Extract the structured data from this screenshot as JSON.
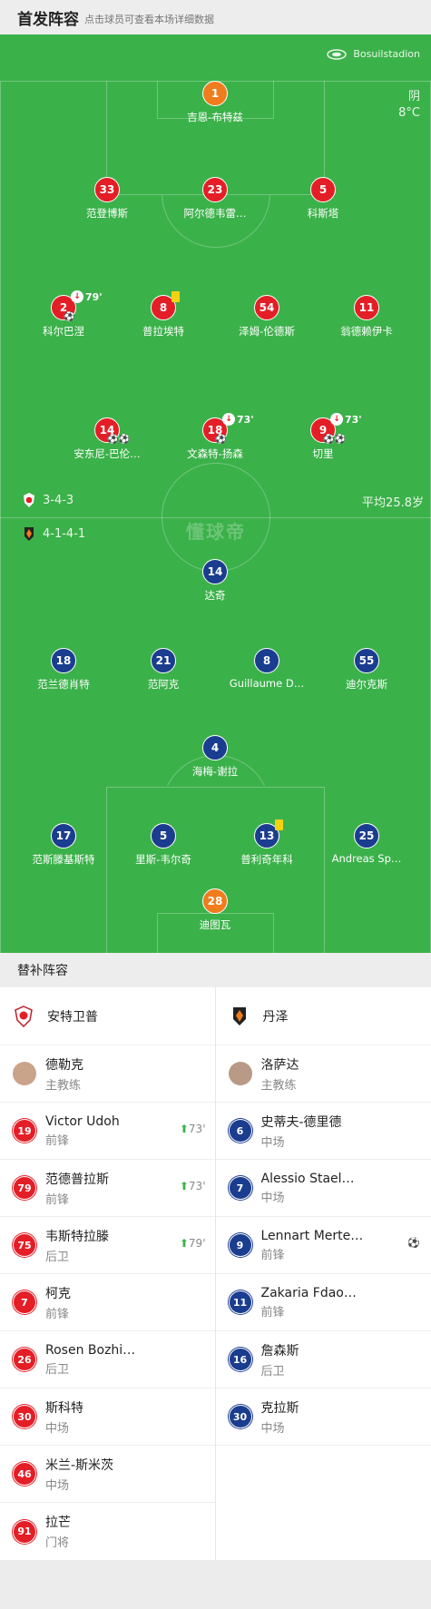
{
  "header": {
    "title": "首发阵容",
    "subtitle": "点击球员可查看本场详细数据"
  },
  "venue": "Bosuilstadion",
  "weather": {
    "cond": "阴",
    "temp": "8°C"
  },
  "watermark": "懂球帝",
  "home_formation": "3-4-3",
  "away_formation": "4-1-4-1",
  "avg_age": "平均25.8岁",
  "home_players": [
    {
      "num": "1",
      "name": "吉恩-布特兹"
    },
    {
      "num": "33",
      "name": "范登博斯"
    },
    {
      "num": "23",
      "name": "阿尔德韦雷…"
    },
    {
      "num": "5",
      "name": "科斯塔"
    },
    {
      "num": "2",
      "name": "科尔巴涅",
      "sub_time": "79'",
      "goals": "⚽"
    },
    {
      "num": "8",
      "name": "普拉埃特"
    },
    {
      "num": "54",
      "name": "泽姆-伦德斯"
    },
    {
      "num": "11",
      "name": "翁德赖伊卡"
    },
    {
      "num": "14",
      "name": "安东尼-巴伦…",
      "goals": "⚽⚽"
    },
    {
      "num": "18",
      "name": "文森特-扬森",
      "sub_time": "73'",
      "goals": "⚽"
    },
    {
      "num": "9",
      "name": "切里",
      "sub_time": "73'",
      "goals": "⚽⚽"
    }
  ],
  "away_players": [
    {
      "num": "14",
      "name": "达奇"
    },
    {
      "num": "18",
      "name": "范兰德肖特"
    },
    {
      "num": "21",
      "name": "范阿克"
    },
    {
      "num": "8",
      "name": "Guillaume D…"
    },
    {
      "num": "55",
      "name": "迪尔克斯"
    },
    {
      "num": "4",
      "name": "海梅-谢拉"
    },
    {
      "num": "17",
      "name": "范斯滕基斯特"
    },
    {
      "num": "5",
      "name": "里斯-韦尔奇"
    },
    {
      "num": "13",
      "name": "普利奇年科"
    },
    {
      "num": "25",
      "name": "Andreas Sp…"
    },
    {
      "num": "28",
      "name": "迪图瓦"
    }
  ],
  "subs_title": "替补阵容",
  "home_team": {
    "name": "安特卫普",
    "coach": "德勒克",
    "coach_role": "主教练"
  },
  "away_team": {
    "name": "丹泽",
    "coach": "洛萨达",
    "coach_role": "主教练"
  },
  "home_subs": [
    {
      "num": "19",
      "name": "Victor Udoh",
      "pos": "前锋",
      "sub_time": "73'"
    },
    {
      "num": "79",
      "name": "范德普拉斯",
      "pos": "前锋",
      "sub_time": "73'"
    },
    {
      "num": "75",
      "name": "韦斯特拉滕",
      "pos": "后卫",
      "sub_time": "79'"
    },
    {
      "num": "7",
      "name": "柯克",
      "pos": "前锋"
    },
    {
      "num": "26",
      "name": "Rosen Bozhi…",
      "pos": "后卫"
    },
    {
      "num": "30",
      "name": "斯科特",
      "pos": "中场"
    },
    {
      "num": "46",
      "name": "米兰-斯米茨",
      "pos": "中场"
    },
    {
      "num": "91",
      "name": "拉芒",
      "pos": "门将"
    }
  ],
  "away_subs": [
    {
      "num": "6",
      "name": "史蒂夫-德里德",
      "pos": "中场"
    },
    {
      "num": "7",
      "name": "Alessio Stael…",
      "pos": "中场"
    },
    {
      "num": "9",
      "name": "Lennart Merte…",
      "pos": "前锋",
      "goal": "⚽"
    },
    {
      "num": "11",
      "name": "Zakaria Fdao…",
      "pos": "前锋"
    },
    {
      "num": "16",
      "name": "詹森斯",
      "pos": "后卫"
    },
    {
      "num": "30",
      "name": "克拉斯",
      "pos": "中场"
    }
  ]
}
